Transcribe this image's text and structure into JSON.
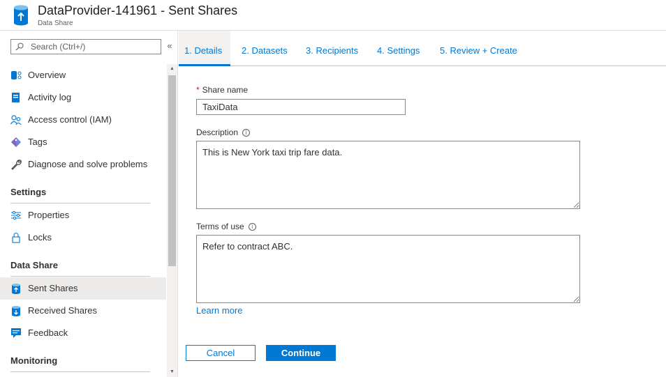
{
  "header": {
    "title": "DataProvider-141961 - Sent Shares",
    "subtitle": "Data Share"
  },
  "sidebar": {
    "search_placeholder": "Search (Ctrl+/)",
    "collapse_glyph": "«",
    "items_top": [
      {
        "label": "Overview",
        "icon": "overview-icon"
      },
      {
        "label": "Activity log",
        "icon": "activity-log-icon"
      },
      {
        "label": "Access control (IAM)",
        "icon": "people-icon"
      },
      {
        "label": "Tags",
        "icon": "tag-icon"
      },
      {
        "label": "Diagnose and solve problems",
        "icon": "wrench-icon"
      }
    ],
    "sections": {
      "settings": "Settings",
      "data_share": "Data Share",
      "monitoring": "Monitoring"
    },
    "items_settings": [
      {
        "label": "Properties",
        "icon": "properties-icon"
      },
      {
        "label": "Locks",
        "icon": "lock-icon"
      }
    ],
    "items_data_share": [
      {
        "label": "Sent Shares",
        "icon": "sent-shares-icon",
        "active": true
      },
      {
        "label": "Received Shares",
        "icon": "received-shares-icon"
      },
      {
        "label": "Feedback",
        "icon": "feedback-icon"
      }
    ]
  },
  "tabs": [
    {
      "label": "1. Details",
      "active": true
    },
    {
      "label": "2. Datasets"
    },
    {
      "label": "3. Recipients"
    },
    {
      "label": "4. Settings"
    },
    {
      "label": "5. Review + Create"
    }
  ],
  "form": {
    "share_name_label": "Share name",
    "required_marker": "*",
    "share_name_value": "TaxiData",
    "description_label": "Description",
    "description_value": "This is New York taxi trip fare data.",
    "terms_label": "Terms of use",
    "terms_value": "Refer to contract ABC.",
    "info_glyph": "i",
    "learn_more": "Learn more"
  },
  "buttons": {
    "cancel": "Cancel",
    "continue": "Continue"
  },
  "colors": {
    "accent": "#0078d4",
    "required": "#a4262c",
    "active_bg": "#edebe9"
  }
}
